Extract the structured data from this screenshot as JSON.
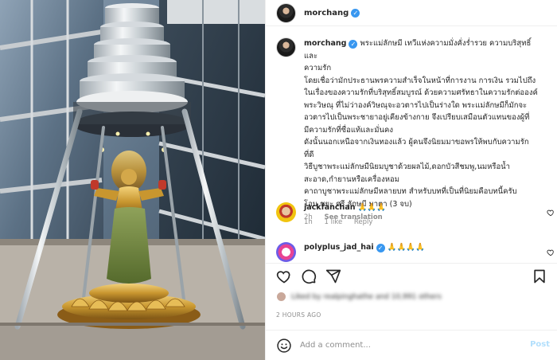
{
  "post": {
    "username": "morchang",
    "caption_lines": [
      "พระแม่ลักษมี เทวีแห่งความมั่งคั่งร่ำรวย ความบริสุทธิ์และ",
      "ความรัก",
      "โดยเชื่อว่ามักประธานพรความสำเร็จในหน้าที่การงาน การเงิน รวมไปถึง",
      "ในเรื่องของความรักที่บริสุทธิ์สมบูรณ์ ด้วยความศรัทธาในความรักต่อองค์",
      "พระวิษณุ ที่ไม่ว่าองค์วิษณุจะอวตารไปเป็นร่างใด พระแม่ลักษมีก็มักจะ",
      "อวตารไปเป็นพระชายาอยู่เคียงข้างกาย จึงเปรียบเสมือนตัวแทนของผู้ที่",
      "มีความรักที่ซื่อแท้และมั่นคง",
      "ดังนั้นนอกเหนือจากเงินทองแล้ว ผู้คนจึงนิยมมาขอพรให้พบกับความรัก",
      "ที่ดี",
      "วิธีบูชาพระแม่ลักษมีนิยมบูชาด้วยผลไม้,ดอกบัวสีชมพู,นมหรือน้ำ",
      "สะอาด,กำยานหรือเครื่องหอม",
      "คาถาบูชาพระแม่ลักษมีหลายบท สำหรับบทที่เป็นที่นิยมคือบทนี้ครับ",
      "โอม ชยะ ศรี ลักษมี มาตา (3 จบ)"
    ],
    "time": "2h",
    "see_translation": "See translation",
    "likes_text": "Liked by realpinghathe and 10,991 others",
    "date": "2 HOURS AGO"
  },
  "comments": [
    {
      "username": "jackfanchan",
      "text": "🙏🙏🙏",
      "time": "1h",
      "likes": "1 like",
      "reply": "Reply"
    },
    {
      "username": "polyplus_jad_hai",
      "text": "🙏🙏🙏🙏"
    }
  ],
  "add_comment": {
    "placeholder": "Add a comment...",
    "post_label": "Post"
  },
  "icons": [
    "heart-icon",
    "comment-icon",
    "share-icon",
    "bookmark-icon",
    "emoji-icon",
    "verified-icon"
  ],
  "colors": {
    "accent": "#3897f0",
    "post_disabled": "#b2dffc",
    "muted": "#8e8e8e"
  }
}
